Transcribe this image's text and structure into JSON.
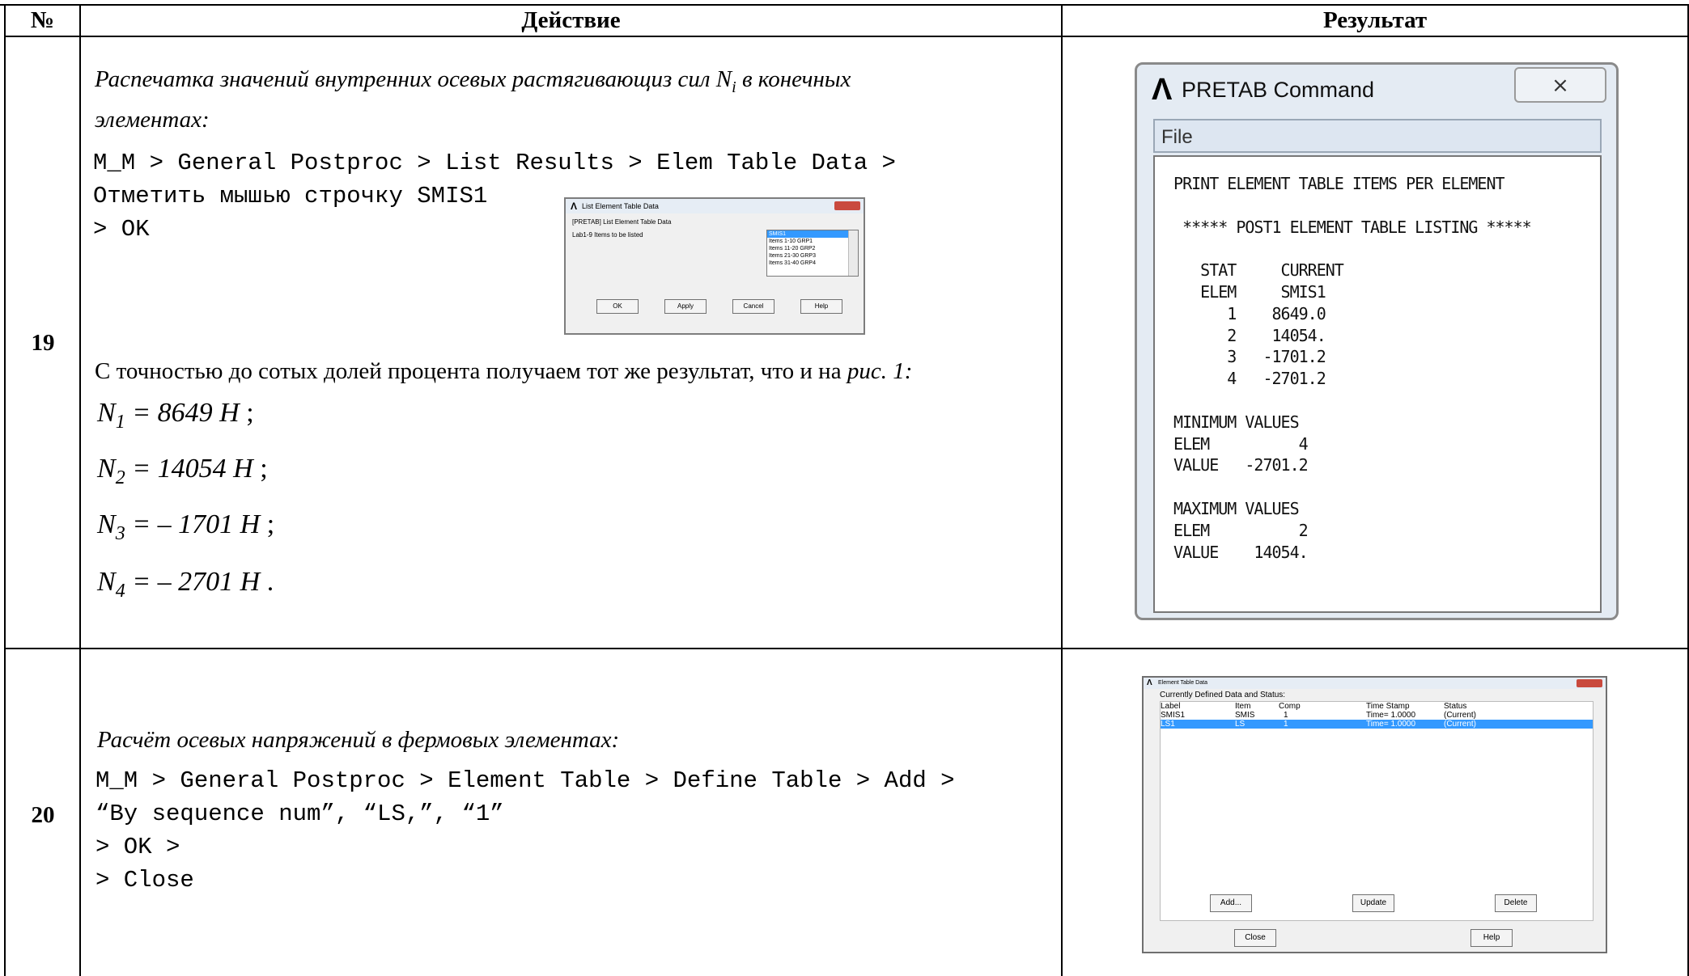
{
  "table": {
    "headers": {
      "num": "№",
      "action": "Действие",
      "result": "Результат"
    },
    "rows": [
      {
        "num": "19",
        "heading_line1": "Распечатка значений внутренних осевых растягивающиз сил  N",
        "heading_sub": "i",
        "heading_line1_end": " в конечных",
        "heading_line2": "элементах:",
        "path_line1": "M_M > General Postproc > List Results > Elem Table Data >",
        "path_line2": "Отметить мышью строчку SMIS1",
        "path_line3": "> OK",
        "note_text": "С точностью до сотых долей процента получаем тот же результат, что и на ",
        "note_ref": "рис. 1:",
        "formulas": [
          {
            "sym": "N",
            "idx": "1",
            "eq": " =   8649 Н",
            "end": "  ;"
          },
          {
            "sym": "N",
            "idx": "2",
            "eq": " =  14054 Н",
            "end": "  ;"
          },
          {
            "sym": "N",
            "idx": "3",
            "eq": " = – 1701 Н",
            "end": "  ;"
          },
          {
            "sym": "N",
            "idx": "4",
            "eq": " = – 2701 Н",
            "end": "  ."
          }
        ]
      },
      {
        "num": "20",
        "heading": "Расчёт осевых напряжений в фермовых элементах:",
        "path_line1": "M_M > General Postproc > Element Table > Define Table > Add >",
        "path_line2": "“By sequence num”, “LS,”, “1”",
        "path_line3": "> OK >",
        "path_line4": "> Close"
      }
    ]
  },
  "list_dialog": {
    "title": "List Element Table Data",
    "label_line": "[PRETAB]  List Element Table Data",
    "field_label": "Lab1-9  Items to be listed",
    "items": [
      "SMIS1",
      "Items 1-10 GRP1",
      "Items 11-20 GRP2",
      "Items 21-30 GRP3",
      "Items 31-40 GRP4"
    ],
    "buttons": [
      "OK",
      "Apply",
      "Cancel",
      "Help"
    ]
  },
  "pretab": {
    "title": "PRETAB  Command",
    "close_glyph": "⨯",
    "menu": "File",
    "output": " PRINT ELEMENT TABLE ITEMS PER ELEMENT\n\n  ***** POST1 ELEMENT TABLE LISTING *****\n\n    STAT     CURRENT\n    ELEM     SMIS1\n       1    8649.0\n       2    14054.\n       3   -1701.2\n       4   -2701.2\n\n MINIMUM VALUES\n ELEM          4\n VALUE   -2701.2\n\n MAXIMUM VALUES\n ELEM          2\n VALUE    14054."
  },
  "element_table_dialog": {
    "title": "Element Table Data",
    "caption": "Currently Defined Data and Status:",
    "columns": [
      "Label",
      "Item",
      "Comp",
      "Time Stamp",
      "Status"
    ],
    "rows": [
      [
        "SMIS1",
        "SMIS",
        "1",
        "Time=  1.0000",
        "(Current)"
      ],
      [
        "LS1",
        "LS",
        "1",
        "Time=  1.0000",
        "(Current)"
      ]
    ],
    "buttons": {
      "add": "Add...",
      "update": "Update",
      "delete": "Delete",
      "close": "Close",
      "help": "Help"
    }
  }
}
